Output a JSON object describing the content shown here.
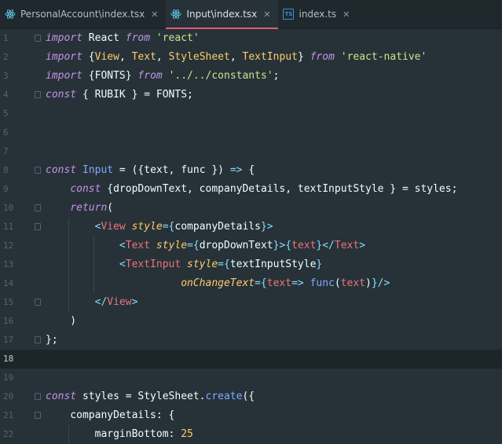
{
  "tabs": [
    {
      "label": "PersonalAccount\\index.tsx",
      "icon": "react-icon",
      "active": false
    },
    {
      "label": "Input\\index.tsx",
      "icon": "react-icon",
      "active": true
    },
    {
      "label": "index.ts",
      "icon": "typescript-icon",
      "active": false
    }
  ],
  "close_glyph": "✕",
  "current_line": 18,
  "colors": {
    "background": "#263238",
    "keyword": "#c792ea",
    "string": "#c3e88d",
    "function": "#82aaff",
    "tag": "#f07178",
    "attribute": "#ffcb6b",
    "active_tab_underline": "#e05a7a"
  },
  "lines": [
    {
      "n": "1",
      "fold": true,
      "guides": [],
      "tokens": [
        [
          "kw",
          "import"
        ],
        [
          "var",
          " React "
        ],
        [
          "kw",
          "from"
        ],
        [
          "var",
          " "
        ],
        [
          "str",
          "'react'"
        ]
      ]
    },
    {
      "n": "2",
      "fold": false,
      "guides": [],
      "tokens": [
        [
          "kw",
          "import"
        ],
        [
          "var",
          " {"
        ],
        [
          "cls",
          "View"
        ],
        [
          "var",
          ", "
        ],
        [
          "cls",
          "Text"
        ],
        [
          "var",
          ", "
        ],
        [
          "cls",
          "StyleSheet"
        ],
        [
          "var",
          ", "
        ],
        [
          "cls",
          "TextInput"
        ],
        [
          "var",
          "} "
        ],
        [
          "kw",
          "from"
        ],
        [
          "var",
          " "
        ],
        [
          "str",
          "'react-native'"
        ]
      ]
    },
    {
      "n": "3",
      "fold": false,
      "guides": [],
      "tokens": [
        [
          "kw",
          "import"
        ],
        [
          "var",
          " {FONTS} "
        ],
        [
          "kw",
          "from"
        ],
        [
          "var",
          " "
        ],
        [
          "str",
          "'../../constants'"
        ],
        [
          "var",
          ";"
        ]
      ]
    },
    {
      "n": "4",
      "fold": true,
      "guides": [],
      "tokens": [
        [
          "kw",
          "const"
        ],
        [
          "var",
          " { RUBIK } = FONTS;"
        ]
      ]
    },
    {
      "n": "5",
      "fold": false,
      "guides": [],
      "tokens": []
    },
    {
      "n": "6",
      "fold": false,
      "guides": [],
      "tokens": []
    },
    {
      "n": "7",
      "fold": false,
      "guides": [],
      "tokens": []
    },
    {
      "n": "8",
      "fold": true,
      "guides": [],
      "tokens": [
        [
          "kw",
          "const"
        ],
        [
          "var",
          " "
        ],
        [
          "fn",
          "Input"
        ],
        [
          "var",
          " = ({"
        ],
        [
          "var",
          "text"
        ],
        [
          "var",
          ", "
        ],
        [
          "var",
          "func"
        ],
        [
          "var",
          " }) "
        ],
        [
          "pun",
          "=>"
        ],
        [
          "var",
          " {"
        ]
      ]
    },
    {
      "n": "9",
      "fold": false,
      "guides": [],
      "tokens": [
        [
          "var",
          "    "
        ],
        [
          "kw",
          "const"
        ],
        [
          "var",
          " {dropDownText, companyDetails, textInputStyle } = styles;"
        ]
      ]
    },
    {
      "n": "10",
      "fold": true,
      "guides": [],
      "tokens": [
        [
          "var",
          "    "
        ],
        [
          "kw",
          "return"
        ],
        [
          "var",
          "("
        ]
      ]
    },
    {
      "n": "11",
      "fold": true,
      "guides": [
        1
      ],
      "tokens": [
        [
          "var",
          "        "
        ],
        [
          "pun",
          "<"
        ],
        [
          "tag",
          "View"
        ],
        [
          "var",
          " "
        ],
        [
          "attr",
          "style"
        ],
        [
          "pun",
          "={"
        ],
        [
          "var",
          "companyDetails"
        ],
        [
          "pun",
          "}>"
        ]
      ]
    },
    {
      "n": "12",
      "fold": false,
      "guides": [
        1,
        2
      ],
      "tokens": [
        [
          "var",
          "            "
        ],
        [
          "pun",
          "<"
        ],
        [
          "tag",
          "Text"
        ],
        [
          "var",
          " "
        ],
        [
          "attr",
          "style"
        ],
        [
          "pun",
          "={"
        ],
        [
          "var",
          "dropDownText"
        ],
        [
          "pun",
          "}>{"
        ],
        [
          "tag",
          "text"
        ],
        [
          "pun",
          "}</"
        ],
        [
          "tag",
          "Text"
        ],
        [
          "pun",
          ">"
        ]
      ]
    },
    {
      "n": "13",
      "fold": false,
      "guides": [
        1,
        2
      ],
      "tokens": [
        [
          "var",
          "            "
        ],
        [
          "pun",
          "<"
        ],
        [
          "tag",
          "TextInput"
        ],
        [
          "var",
          " "
        ],
        [
          "attr",
          "style"
        ],
        [
          "pun",
          "={"
        ],
        [
          "var",
          "textInputStyle"
        ],
        [
          "pun",
          "}"
        ]
      ]
    },
    {
      "n": "14",
      "fold": false,
      "guides": [
        1,
        2
      ],
      "tokens": [
        [
          "var",
          "                      "
        ],
        [
          "attr",
          "onChangeText"
        ],
        [
          "pun",
          "={"
        ],
        [
          "tag",
          "text"
        ],
        [
          "pun",
          "=>"
        ],
        [
          "var",
          " "
        ],
        [
          "fn",
          "func"
        ],
        [
          "var",
          "("
        ],
        [
          "tag",
          "text"
        ],
        [
          "var",
          ")"
        ],
        [
          "pun",
          "}/>"
        ]
      ]
    },
    {
      "n": "15",
      "fold": true,
      "guides": [
        1
      ],
      "tokens": [
        [
          "var",
          "        "
        ],
        [
          "pun",
          "</"
        ],
        [
          "tag",
          "View"
        ],
        [
          "pun",
          ">"
        ]
      ]
    },
    {
      "n": "16",
      "fold": false,
      "guides": [],
      "tokens": [
        [
          "var",
          "    )"
        ]
      ]
    },
    {
      "n": "17",
      "fold": true,
      "guides": [],
      "tokens": [
        [
          "var",
          "};"
        ]
      ]
    },
    {
      "n": "18",
      "fold": false,
      "guides": [],
      "tokens": []
    },
    {
      "n": "19",
      "fold": false,
      "guides": [],
      "tokens": []
    },
    {
      "n": "20",
      "fold": true,
      "guides": [],
      "tokens": [
        [
          "kw",
          "const"
        ],
        [
          "var",
          " styles = StyleSheet."
        ],
        [
          "fn",
          "create"
        ],
        [
          "var",
          "({"
        ]
      ]
    },
    {
      "n": "21",
      "fold": true,
      "guides": [],
      "tokens": [
        [
          "var",
          "    companyDetails: {"
        ]
      ]
    },
    {
      "n": "22",
      "fold": false,
      "guides": [
        1
      ],
      "tokens": [
        [
          "var",
          "        marginBottom: "
        ],
        [
          "cls",
          "25"
        ]
      ]
    }
  ]
}
